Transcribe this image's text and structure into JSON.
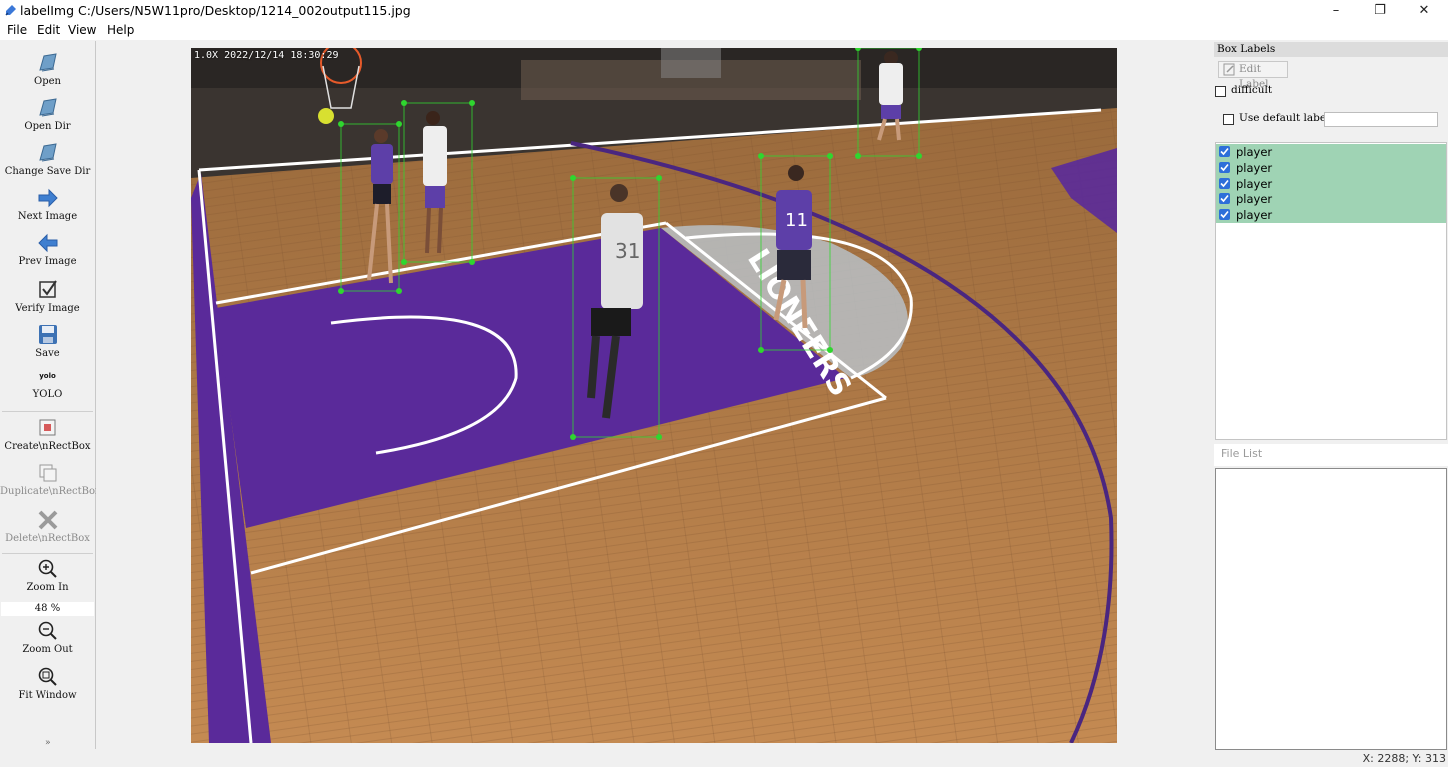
{
  "window": {
    "title": "labelImg C:/Users/N5W11pro/Desktop/1214_002output115.jpg",
    "controls": {
      "minimize": "–",
      "maximize": "❐",
      "close": "✕"
    }
  },
  "menu": [
    "File",
    "Edit",
    "View",
    "Help"
  ],
  "toolbar": {
    "open": "Open",
    "open_dir": "Open Dir",
    "change_save_dir": "Change Save Dir",
    "next_image": "Next Image",
    "prev_image": "Prev Image",
    "verify_image": "Verify Image",
    "save": "Save",
    "format_icon_text": "yolo",
    "format": "YOLO",
    "create_rectbox": "Create\\nRectBox",
    "duplicate_rectbox": "Duplicate\\nRectBox",
    "delete_rectbox": "Delete\\nRectBox",
    "zoom_in": "Zoom In",
    "zoom_value": "48 %",
    "zoom_out": "Zoom Out",
    "fit_window": "Fit Window"
  },
  "canvas": {
    "overlay_text": "1.0X 2022/12/14 18:30:29",
    "court_text": "LIONEERS",
    "jersey_numbers": [
      "31",
      "11"
    ]
  },
  "box_labels": {
    "title": "Box Labels",
    "edit_label": "Edit Label",
    "difficult": "difficult",
    "use_default_label": "Use default label",
    "default_label_value": "",
    "items": [
      {
        "label": "player",
        "checked": true
      },
      {
        "label": "player",
        "checked": true
      },
      {
        "label": "player",
        "checked": true
      },
      {
        "label": "player",
        "checked": true
      },
      {
        "label": "player",
        "checked": true
      }
    ]
  },
  "file_list": {
    "title": "File List"
  },
  "status": {
    "coords": "X: 2288; Y: 313"
  },
  "colors": {
    "box_stroke": "#2fd62f",
    "label_row_bg": "#9fd3b4",
    "court_purple": "#5a2a9a",
    "floor_wood": "#b07a45"
  }
}
